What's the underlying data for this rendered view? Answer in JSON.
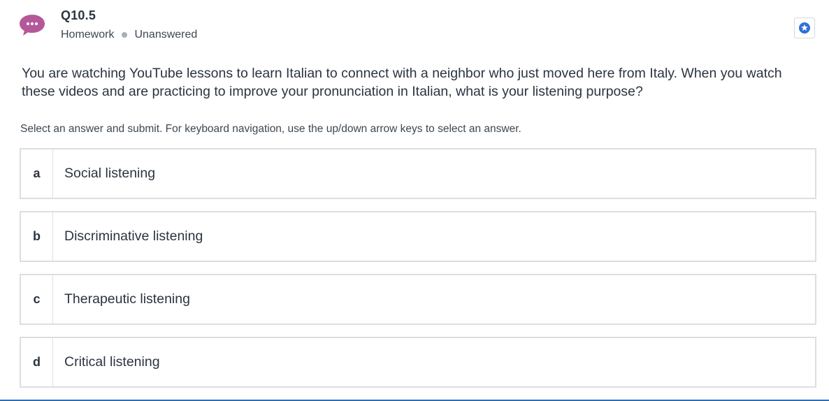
{
  "header": {
    "question_id": "Q10.5",
    "assignment_type": "Homework",
    "status": "Unanswered"
  },
  "icons": {
    "avatar": "chat-bubble-ellipsis-icon",
    "bookmark": "star-icon"
  },
  "colors": {
    "avatar_bubble": "#b5589a",
    "star_accent": "#2f6fd6",
    "border": "#dcdfe2",
    "bottom_bar": "#2c6fb5"
  },
  "question": {
    "text": "You are watching YouTube lessons to learn Italian to connect with a neighbor who just moved here from Italy. When you watch these videos and are practicing to improve your pronunciation in Italian, what is your listening purpose?"
  },
  "instructions": "Select an answer and submit. For keyboard navigation, use the up/down arrow keys to select an answer.",
  "options": [
    {
      "letter": "a",
      "text": "Social listening"
    },
    {
      "letter": "b",
      "text": "Discriminative listening"
    },
    {
      "letter": "c",
      "text": "Therapeutic listening"
    },
    {
      "letter": "d",
      "text": "Critical listening"
    }
  ]
}
